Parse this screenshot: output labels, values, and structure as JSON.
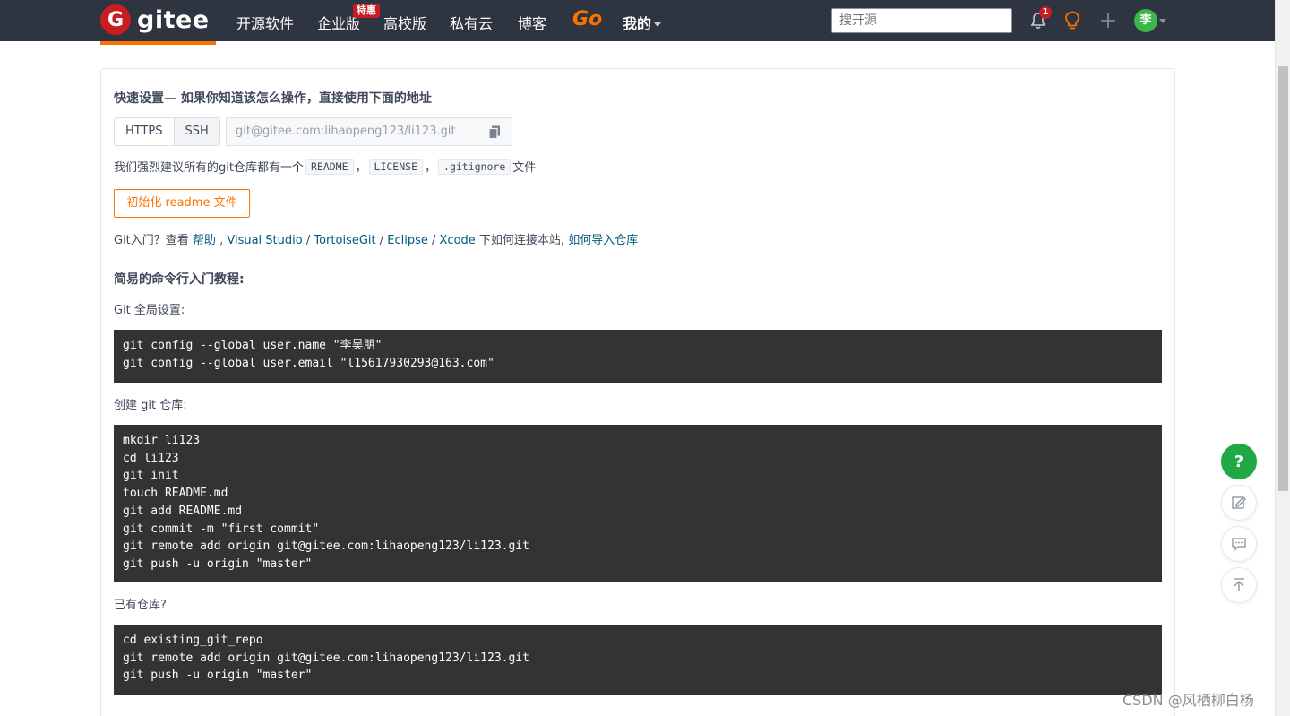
{
  "nav": {
    "logo_mark": "G",
    "logo_text": "gitee",
    "items": [
      "开源软件",
      "企业版",
      "高校版",
      "私有云",
      "博客"
    ],
    "badge": "特惠",
    "go": "Go",
    "mine": "我的",
    "search_placeholder": "搜开源",
    "notif_count": "1",
    "avatar_text": "李"
  },
  "quick": {
    "title": "快速设置— 如果你知道该怎么操作，直接使用下面的地址",
    "protocols": [
      "HTTPS",
      "SSH"
    ],
    "active_protocol": "SSH",
    "url": "git@gitee.com:lihaopeng123/li123.git",
    "recommend_prefix": "我们强烈建议所有的git仓库都有一个",
    "files": [
      "README",
      "LICENSE",
      ".gitignore"
    ],
    "sep": "，",
    "recommend_suffix": "文件",
    "init_button": "初始化 readme 文件"
  },
  "intro": {
    "prefix": "Git入门？查看 ",
    "help": "帮助",
    "sep1": " , ",
    "vs": "Visual Studio",
    "slash1": " / ",
    "tortoise": "TortoiseGit",
    "slash2": " / ",
    "eclipse": "Eclipse",
    "slash3": " / ",
    "xcode": "Xcode",
    "middle": " 下如何连接本站, ",
    "import": "如何导入仓库"
  },
  "tutorial": {
    "title": "简易的命令行入门教程:",
    "global_label": "Git 全局设置:",
    "global_code": [
      "git config --global user.name \"李昊朋\"",
      "git config --global user.email \"l15617930293@163.com\""
    ],
    "create_label": "创建 git 仓库:",
    "create_code": [
      "mkdir li123",
      "cd li123",
      "git init",
      "touch README.md",
      "git add README.md",
      "git commit -m \"first commit\"",
      "git remote add origin git@gitee.com:lihaopeng123/li123.git",
      "git push -u origin \"master\""
    ],
    "existing_label": "已有仓库?",
    "existing_code": [
      "cd existing_git_repo",
      "git remote add origin git@gitee.com:lihaopeng123/li123.git",
      "git push -u origin \"master\""
    ]
  },
  "float": {
    "help": "?"
  },
  "watermark": "CSDN @风栖柳白杨",
  "colors": {
    "nav_bg": "#2e3440",
    "brand_red": "#c71d23",
    "accent_orange": "#fe7300",
    "code_bg": "#333333",
    "link": "#005980",
    "help_green": "#1fa843"
  }
}
